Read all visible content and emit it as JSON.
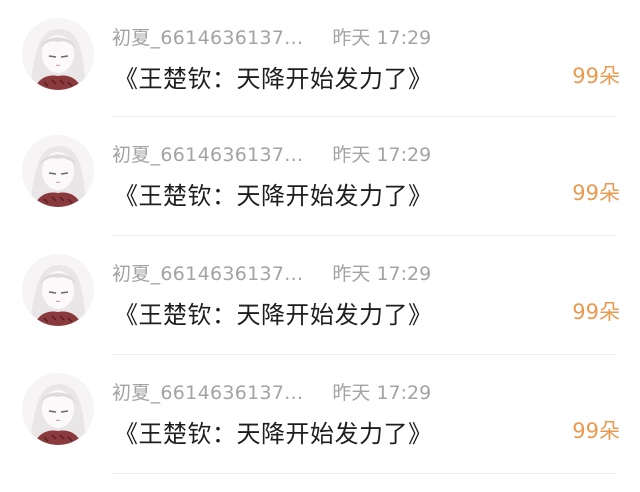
{
  "comments": [
    {
      "username": "初夏_6614636137...",
      "time": "昨天 17:29",
      "message": "《王楚钦：天降开始发力了》",
      "gift": "99朵"
    },
    {
      "username": "初夏_6614636137...",
      "time": "昨天 17:29",
      "message": "《王楚钦：天降开始发力了》",
      "gift": "99朵"
    },
    {
      "username": "初夏_6614636137...",
      "time": "昨天 17:29",
      "message": "《王楚钦：天降开始发力了》",
      "gift": "99朵"
    },
    {
      "username": "初夏_6614636137...",
      "time": "昨天 17:29",
      "message": "《王楚钦：天降开始发力了》",
      "gift": "99朵"
    }
  ],
  "colors": {
    "meta_text": "#a3a3a3",
    "message_text": "#1e1e1e",
    "gift_accent": "#e99a4f",
    "divider": "#eeeeee"
  }
}
